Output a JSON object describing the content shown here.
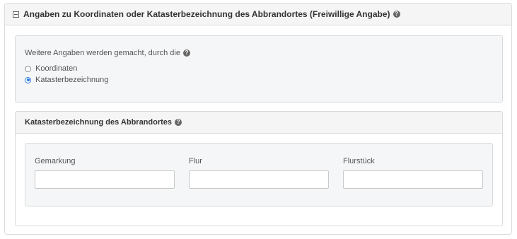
{
  "outer_panel": {
    "title": "Angaben zu Koordinaten oder Katasterbezeichnung des Abbrandortes (Freiwillige Angabe)",
    "toggle_icon": "minus-square-icon",
    "help_icon": "question-circle-icon",
    "help_glyph": "?"
  },
  "choice": {
    "question": "Weitere Angaben werden gemacht, durch die",
    "help_glyph": "?",
    "options": [
      {
        "label": "Koordinaten",
        "checked": false
      },
      {
        "label": "Katasterbezeichnung",
        "checked": true
      }
    ],
    "accent_color": "#2a7ae4"
  },
  "kataster_panel": {
    "title": "Katasterbezeichnung des Abbrandortes",
    "help_glyph": "?",
    "fields": [
      {
        "label": "Gemarkung",
        "value": ""
      },
      {
        "label": "Flur",
        "value": ""
      },
      {
        "label": "Flurstück",
        "value": ""
      }
    ]
  }
}
